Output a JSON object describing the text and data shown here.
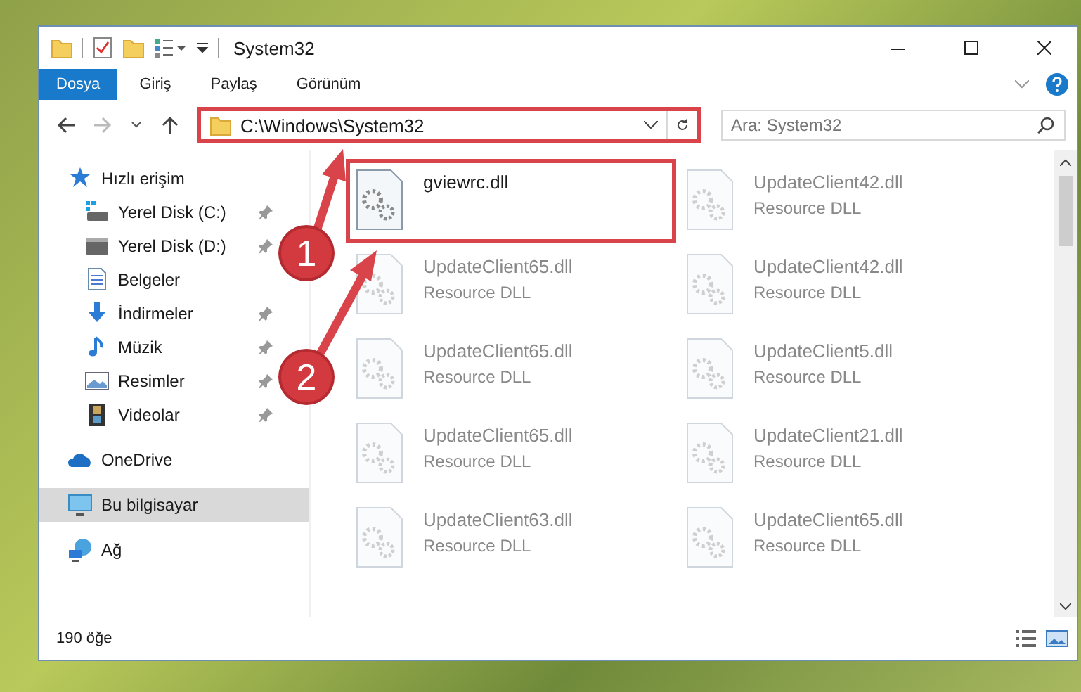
{
  "window": {
    "title": "System32"
  },
  "ribbon": {
    "tabs": [
      {
        "label": "Dosya",
        "selected": true
      },
      {
        "label": "Giriş",
        "selected": false
      },
      {
        "label": "Paylaş",
        "selected": false
      },
      {
        "label": "Görünüm",
        "selected": false
      }
    ]
  },
  "address_bar": {
    "path": "C:\\Windows\\System32",
    "highlighted": true
  },
  "search": {
    "placeholder": "Ara: System32"
  },
  "sidebar": {
    "items": [
      {
        "label": "Hızlı erişim",
        "kind": "star",
        "selected": false,
        "children": [
          {
            "label": "Yerel Disk (C:)",
            "kind": "system-drive",
            "pinned": true,
            "selected": false
          },
          {
            "label": "Yerel Disk (D:)",
            "kind": "drive",
            "pinned": true,
            "selected": false
          },
          {
            "label": "Belgeler",
            "kind": "documents",
            "pinned": false,
            "selected": false
          },
          {
            "label": "İndirmeler",
            "kind": "downloads",
            "pinned": true,
            "selected": false
          },
          {
            "label": "Müzik",
            "kind": "music",
            "pinned": true,
            "selected": false
          },
          {
            "label": "Resimler",
            "kind": "pictures",
            "pinned": true,
            "selected": false
          },
          {
            "label": "Videolar",
            "kind": "videos",
            "pinned": true,
            "selected": false
          }
        ]
      },
      {
        "label": "OneDrive",
        "kind": "cloud",
        "selected": false
      },
      {
        "label": "Bu bilgisayar",
        "kind": "computer",
        "selected": true
      },
      {
        "label": "Ağ",
        "kind": "network",
        "selected": false
      }
    ]
  },
  "files": [
    {
      "name": "gviewrc.dll",
      "highlighted": true,
      "dimmed": false
    },
    {
      "name": "UpdateClient42.dll",
      "subtitle": "Resource DLL",
      "highlighted": false,
      "dimmed": true
    },
    {
      "name": "UpdateClient65.dll",
      "subtitle": "Resource DLL",
      "highlighted": false,
      "dimmed": true
    },
    {
      "name": "UpdateClient42.dll",
      "subtitle": "Resource DLL",
      "highlighted": false,
      "dimmed": true
    },
    {
      "name": "UpdateClient65.dll",
      "subtitle": "Resource DLL",
      "highlighted": false,
      "dimmed": true
    },
    {
      "name": "UpdateClient5.dll",
      "subtitle": "Resource DLL",
      "highlighted": false,
      "dimmed": true
    },
    {
      "name": "UpdateClient65.dll",
      "subtitle": "Resource DLL",
      "highlighted": false,
      "dimmed": true
    },
    {
      "name": "UpdateClient21.dll",
      "subtitle": "Resource DLL",
      "highlighted": false,
      "dimmed": true
    },
    {
      "name": "UpdateClient63.dll",
      "subtitle": "Resource DLL",
      "highlighted": false,
      "dimmed": true
    },
    {
      "name": "UpdateClient65.dll",
      "subtitle": "Resource DLL",
      "highlighted": false,
      "dimmed": true
    }
  ],
  "status_bar": {
    "count": "190 öğe"
  },
  "annotations": [
    {
      "number": "1"
    },
    {
      "number": "2"
    }
  ]
}
